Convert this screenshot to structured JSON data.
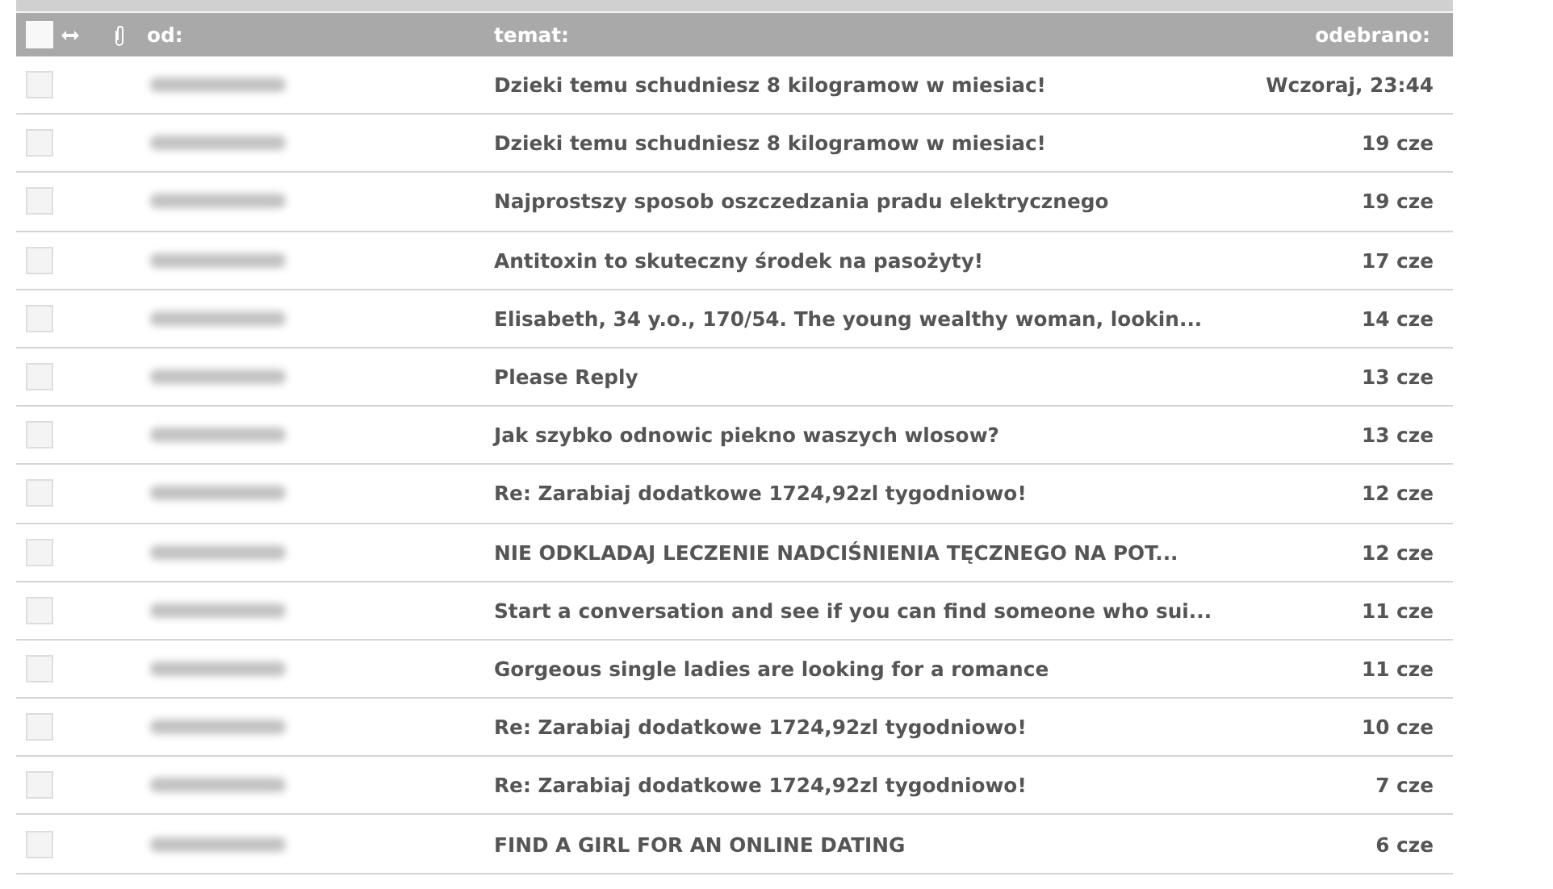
{
  "columns": {
    "from": "od:",
    "subject": "temat:",
    "received": "odebrano:"
  },
  "select_all": {
    "checked": false
  },
  "messages": [
    {
      "subject": "Dzieki temu schudniesz 8 kilogramow w miesiac!",
      "received": "Wczoraj, 23:44",
      "checked": false
    },
    {
      "subject": "Dzieki temu schudniesz 8 kilogramow w miesiac!",
      "received": "19 cze",
      "checked": false
    },
    {
      "subject": "Najprostszy sposob oszczedzania pradu elektrycznego",
      "received": "19 cze",
      "checked": false
    },
    {
      "subject": "Antitoxin to skuteczny środek na pasożyty!",
      "received": "17 cze",
      "checked": false
    },
    {
      "subject": "Elisabeth, 34 y.o., 170/54. The young wealthy woman, lookin...",
      "received": "14 cze",
      "checked": false
    },
    {
      "subject": "Please Reply",
      "received": "13 cze",
      "checked": false
    },
    {
      "subject": "Jak szybko odnowic piekno waszych wlosow?",
      "received": "13 cze",
      "checked": false
    },
    {
      "subject": "Re: Zarabiaj dodatkowe 1724,92zl tygodniowo!",
      "received": "12 cze",
      "checked": false
    },
    {
      "subject": "NIE ODKLADAJ LECZENIE NADCIŚNIENIA TĘCZNEGO NA POT...",
      "received": "12 cze",
      "checked": false
    },
    {
      "subject": "Start a conversation and see if you can find someone who sui...",
      "received": "11 cze",
      "checked": false
    },
    {
      "subject": "Gorgeous single ladies are looking for a romance",
      "received": "11 cze",
      "checked": false
    },
    {
      "subject": "Re: Zarabiaj dodatkowe 1724,92zl tygodniowo!",
      "received": "10 cze",
      "checked": false
    },
    {
      "subject": "Re: Zarabiaj dodatkowe 1724,92zl tygodniowo!",
      "received": "7 cze",
      "checked": false
    },
    {
      "subject": "FIND A GIRL FOR AN ONLINE DATING",
      "received": "6 cze",
      "checked": false
    }
  ]
}
